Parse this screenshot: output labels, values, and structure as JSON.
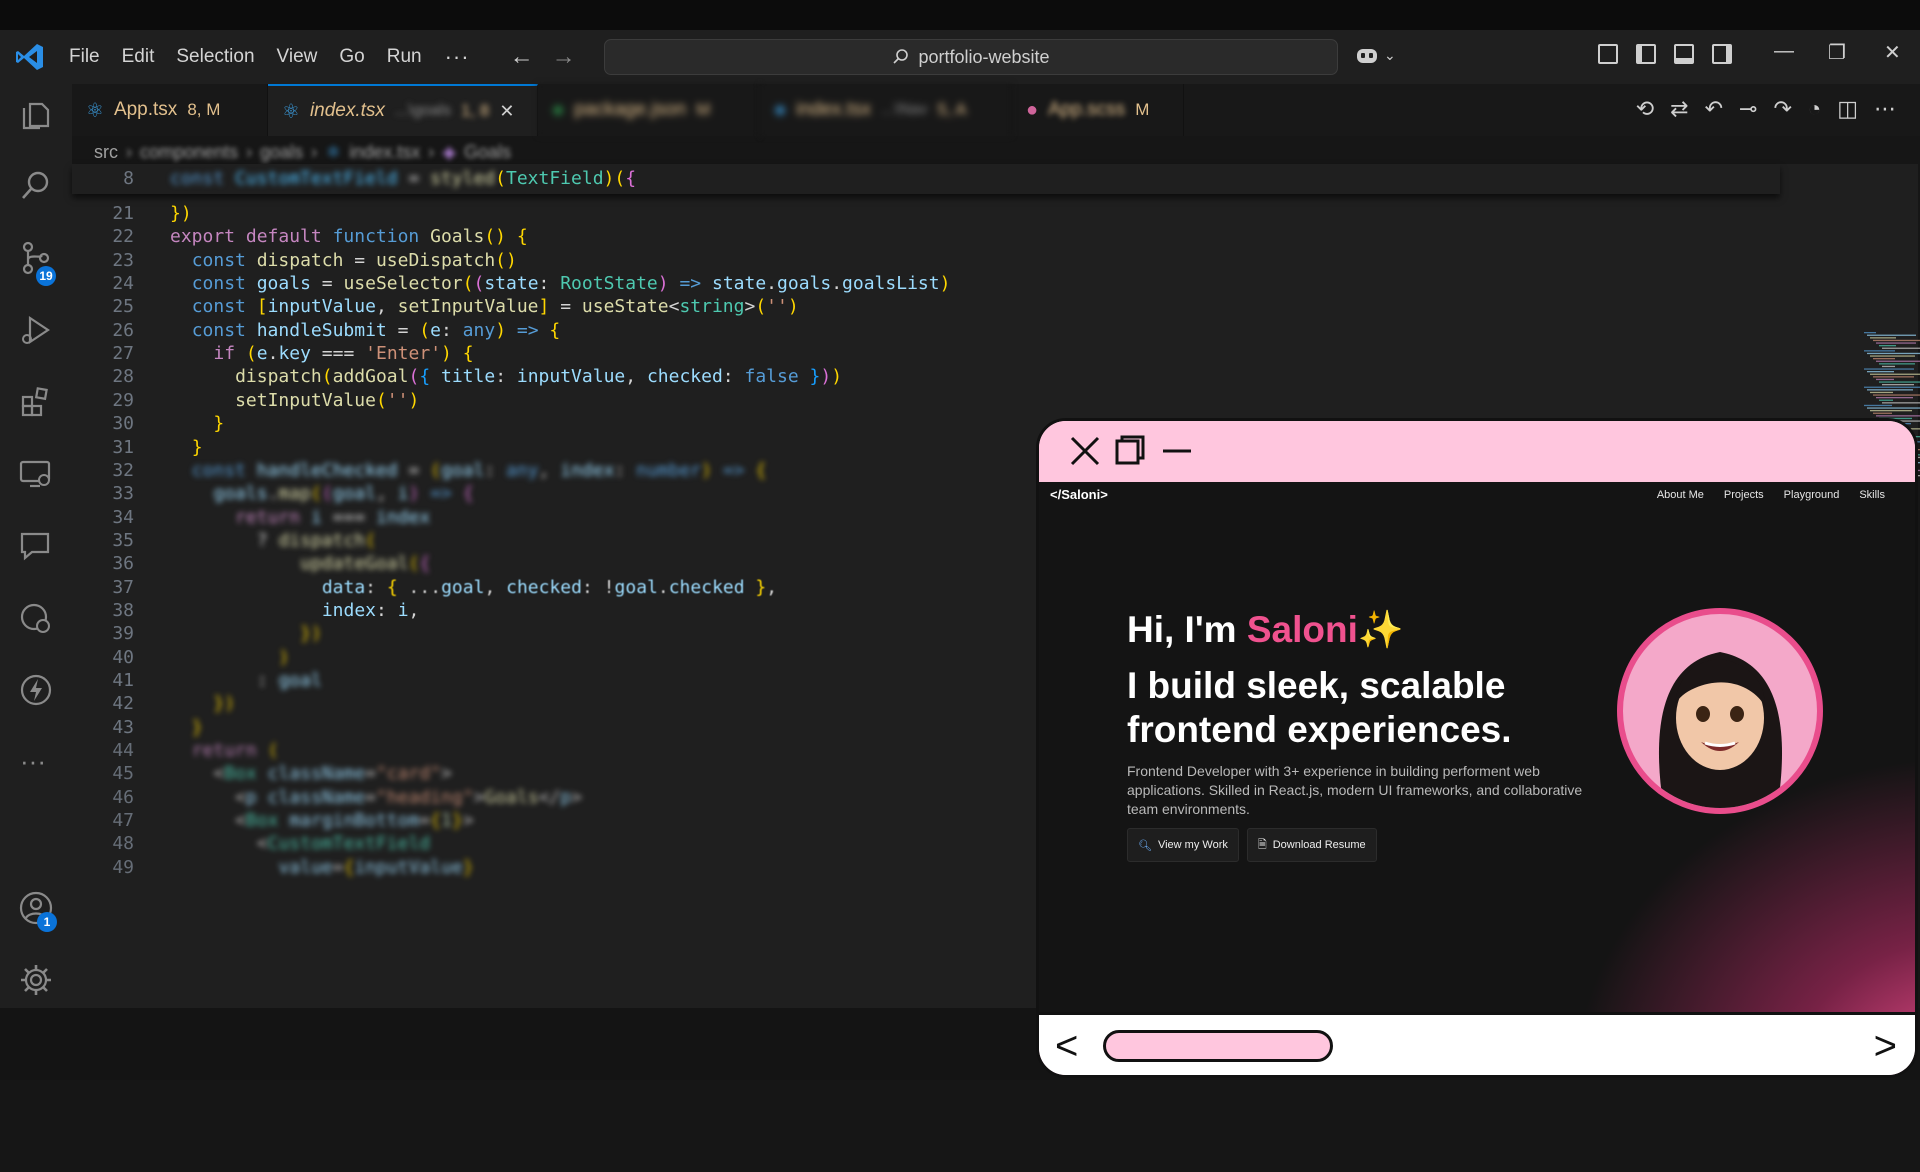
{
  "menu": [
    "File",
    "Edit",
    "Selection",
    "View",
    "Go",
    "Run"
  ],
  "menu_more": "···",
  "command_center": {
    "text": "portfolio-website"
  },
  "activity": {
    "source_control_badge": "19",
    "accounts_badge": "1",
    "more": "···"
  },
  "tabs": [
    {
      "name": "App.tsx",
      "status": "8, M",
      "color": "#e2c08d"
    },
    {
      "name": "index.tsx",
      "desc": "...\\goals",
      "status": "1, 8",
      "color": "#e2c08d",
      "active": true
    },
    {
      "name": "package.json",
      "status": "M",
      "color": "#e2c08d"
    },
    {
      "name": "index.tsx",
      "desc": "...\\Nav",
      "status": "5, A",
      "color": "#e2c08d"
    },
    {
      "name": "App.scss",
      "status": "M",
      "color": "#e2c08d"
    }
  ],
  "breadcrumb": {
    "root": "src",
    "parts": [
      "components",
      "goals",
      "index.tsx",
      "Goals"
    ]
  },
  "code": {
    "sticky": {
      "num": "8",
      "text": "const CustomTextField = styled(TextField)({"
    },
    "lines": [
      {
        "num": "21",
        "text": "})"
      },
      {
        "num": "22",
        "text": "export default function Goals() {"
      },
      {
        "num": "23",
        "text": "  const dispatch = useDispatch()"
      },
      {
        "num": "24",
        "text": "  const goals = useSelector((state: RootState) => state.goals.goalsList)"
      },
      {
        "num": "25",
        "text": "  const [inputValue, setInputValue] = useState<string>('')"
      },
      {
        "num": "26",
        "text": "  const handleSubmit = (e: any) => {"
      },
      {
        "num": "27",
        "text": "    if (e.key === 'Enter') {"
      },
      {
        "num": "28",
        "text": "      dispatch(addGoal({ title: inputValue, checked: false }))"
      },
      {
        "num": "29",
        "text": "      setInputValue('')"
      },
      {
        "num": "30",
        "text": "    }"
      },
      {
        "num": "31",
        "text": "  }"
      },
      {
        "num": "32",
        "text": "  const handleChecked = (goal: any, index: number) => {"
      },
      {
        "num": "33",
        "text": "    goals.map((goal, i) => {"
      },
      {
        "num": "34",
        "text": "      return i === index"
      },
      {
        "num": "35",
        "text": "        ? dispatch("
      },
      {
        "num": "36",
        "text": "            updateGoal({"
      },
      {
        "num": "37",
        "text": "              data: { ...goal, checked: !goal.checked },"
      },
      {
        "num": "38",
        "text": "              index: i,"
      },
      {
        "num": "39",
        "text": "            })"
      },
      {
        "num": "40",
        "text": "          )"
      },
      {
        "num": "41",
        "text": "        : goal"
      },
      {
        "num": "42",
        "text": "    })"
      },
      {
        "num": "43",
        "text": "  }"
      },
      {
        "num": "44",
        "text": "  return ("
      },
      {
        "num": "45",
        "text": "    <Box className=\"card\">"
      },
      {
        "num": "46",
        "text": "      <p className=\"heading\">Goals</p>"
      },
      {
        "num": "47",
        "text": "      <Box marginBottom={1}>"
      },
      {
        "num": "48",
        "text": "        <CustomTextField"
      },
      {
        "num": "49",
        "text": "          value={inputValue}"
      }
    ]
  },
  "browser": {
    "logo": "</Saloni>",
    "nav_links": [
      "About Me",
      "Projects",
      "Playground",
      "Skills"
    ],
    "hi_prefix": "Hi, I'm ",
    "hi_name": "Saloni",
    "hi_emoji": "✨",
    "headline": "I build sleek, scalable frontend experiences.",
    "description": "Frontend Developer with 3+ experience in building performent web applications. Skilled in React.js, modern UI frameworks, and collaborative team environments.",
    "btn_work": "View my Work",
    "btn_resume": "Download Resume",
    "nav_prev": "<",
    "nav_next": ">"
  },
  "colors": {
    "accent_pink": "#f0528f",
    "window_pink": "#ffc6de",
    "vscode_blue": "#0078d4"
  }
}
